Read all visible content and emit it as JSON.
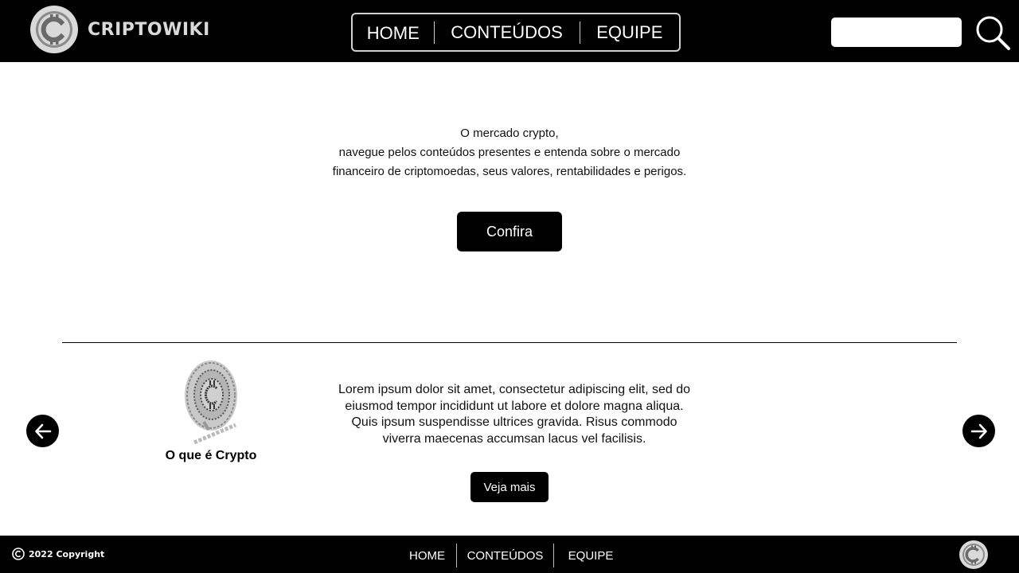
{
  "header": {
    "brand": "CRIPTOWIKI",
    "logo_icon": "bitcoin-coin-icon",
    "nav": [
      {
        "label": "HOME"
      },
      {
        "label": "CONTEÚDOS"
      },
      {
        "label": "EQUIPE"
      }
    ],
    "search": {
      "placeholder": "",
      "value": "",
      "icon": "search-icon"
    }
  },
  "hero": {
    "lines": [
      "O mercado crypto,",
      "navegue pelos conteúdos presentes e entenda sobre o mercado",
      "financeiro de criptomoedas, seus valores, rentabilidades e perigos."
    ],
    "cta_label": "Confira"
  },
  "carousel": {
    "prev_icon": "arrow-left-icon",
    "next_icon": "arrow-right-icon",
    "card": {
      "image_icon": "bitcoin-coin-image",
      "title": "O que é Crypto",
      "text": "Lorem ipsum dolor sit amet, consectetur adipiscing elit, sed do eiusmod tempor incididunt ut labore et dolore magna aliqua. Quis ipsum suspendisse ultrices gravida. Risus commodo viverra maecenas accumsan lacus vel facilisis.",
      "button_label": "Veja mais"
    }
  },
  "footer": {
    "copyright": "2022 Copyright",
    "nav": [
      {
        "label": "HOME"
      },
      {
        "label": "CONTEÚDOS"
      },
      {
        "label": "EQUIPE"
      }
    ],
    "logo_icon": "bitcoin-coin-icon"
  },
  "colors": {
    "header_bg": "#000000",
    "footer_bg": "#000000",
    "page_bg": "#ffffff",
    "button_bg": "#000000",
    "logo_grey": "#d9d9d9"
  }
}
